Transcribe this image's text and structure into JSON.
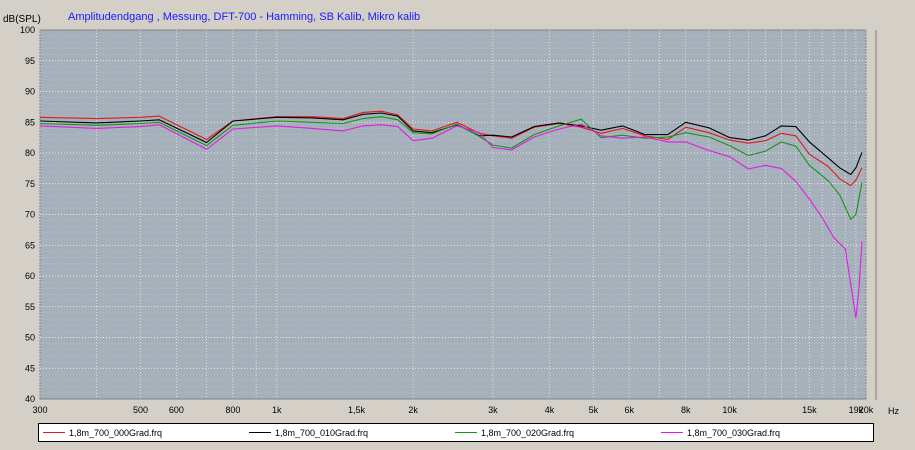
{
  "window_title": "Amplitudendgang , Messung, DFT-700 - Hamming, SB Kalib, Mikro kalib",
  "chart_data": {
    "type": "line",
    "title": "Amplitudendgang , Messung, DFT-700 - Hamming, SB Kalib, Mikro kalib",
    "ylabel": "dB(SPL)",
    "xlabel": "Hz",
    "xscale": "log",
    "xlim": [
      300,
      20000
    ],
    "ylim": [
      40,
      100
    ],
    "grid": true,
    "legend_placement": "bottom",
    "x_ticks": [
      {
        "v": 300,
        "label": "300"
      },
      {
        "v": 500,
        "label": "500"
      },
      {
        "v": 600,
        "label": "600"
      },
      {
        "v": 800,
        "label": "800"
      },
      {
        "v": 1000,
        "label": "1k"
      },
      {
        "v": 1500,
        "label": "1,5k"
      },
      {
        "v": 2000,
        "label": "2k"
      },
      {
        "v": 3000,
        "label": "3k"
      },
      {
        "v": 4000,
        "label": "4k"
      },
      {
        "v": 5000,
        "label": "5k"
      },
      {
        "v": 6000,
        "label": "6k"
      },
      {
        "v": 8000,
        "label": "8k"
      },
      {
        "v": 10000,
        "label": "10k"
      },
      {
        "v": 15000,
        "label": "15k"
      },
      {
        "v": 19000,
        "label": "19k"
      },
      {
        "v": 20000,
        "label": "20k"
      }
    ],
    "y_ticks": [
      100,
      95,
      90,
      85,
      80,
      75,
      70,
      65,
      60,
      55,
      50,
      45,
      40
    ],
    "colors": {
      "plot_bg": "#a5b0bb",
      "grid": "#ffffff",
      "title": "#1a1aff",
      "window_bg": "#d4d0c8"
    },
    "series": [
      {
        "name": "1,8m_700_000Grad.frq",
        "color": "#e01a1a",
        "points": [
          [
            300,
            85.8
          ],
          [
            400,
            85.6
          ],
          [
            500,
            85.8
          ],
          [
            550,
            86.0
          ],
          [
            700,
            82.2
          ],
          [
            800,
            85.2
          ],
          [
            1000,
            85.9
          ],
          [
            1200,
            85.9
          ],
          [
            1400,
            85.6
          ],
          [
            1550,
            86.6
          ],
          [
            1700,
            86.8
          ],
          [
            1850,
            86.2
          ],
          [
            2000,
            83.9
          ],
          [
            2200,
            83.6
          ],
          [
            2500,
            85.0
          ],
          [
            2800,
            83.2
          ],
          [
            3000,
            82.8
          ],
          [
            3300,
            82.4
          ],
          [
            3700,
            84.2
          ],
          [
            4200,
            84.8
          ],
          [
            4700,
            84.2
          ],
          [
            5200,
            83.2
          ],
          [
            5800,
            84.0
          ],
          [
            6500,
            82.8
          ],
          [
            7300,
            82.2
          ],
          [
            8000,
            84.2
          ],
          [
            9000,
            83.3
          ],
          [
            10000,
            82.1
          ],
          [
            11000,
            81.6
          ],
          [
            12000,
            82.0
          ],
          [
            13000,
            83.2
          ],
          [
            14000,
            82.8
          ],
          [
            15000,
            79.8
          ],
          [
            16500,
            77.8
          ],
          [
            17500,
            75.8
          ],
          [
            18500,
            74.7
          ],
          [
            19000,
            75.6
          ],
          [
            19600,
            77.6
          ]
        ]
      },
      {
        "name": "1,8m_700_010Grad.frq",
        "color": "#000000",
        "points": [
          [
            300,
            85.2
          ],
          [
            400,
            84.9
          ],
          [
            500,
            85.2
          ],
          [
            550,
            85.4
          ],
          [
            700,
            81.7
          ],
          [
            800,
            85.2
          ],
          [
            1000,
            85.8
          ],
          [
            1200,
            85.7
          ],
          [
            1400,
            85.4
          ],
          [
            1550,
            86.3
          ],
          [
            1700,
            86.5
          ],
          [
            1850,
            86.0
          ],
          [
            2000,
            83.6
          ],
          [
            2200,
            83.3
          ],
          [
            2500,
            84.6
          ],
          [
            2800,
            82.8
          ],
          [
            3000,
            82.9
          ],
          [
            3300,
            82.6
          ],
          [
            3700,
            84.3
          ],
          [
            4200,
            84.9
          ],
          [
            4700,
            84.4
          ],
          [
            5200,
            83.7
          ],
          [
            5800,
            84.4
          ],
          [
            6500,
            83.0
          ],
          [
            7300,
            83.0
          ],
          [
            8000,
            85.0
          ],
          [
            9000,
            84.1
          ],
          [
            10000,
            82.5
          ],
          [
            11000,
            82.1
          ],
          [
            12000,
            82.8
          ],
          [
            13000,
            84.4
          ],
          [
            14000,
            84.3
          ],
          [
            15000,
            81.8
          ],
          [
            16500,
            79.2
          ],
          [
            17500,
            77.6
          ],
          [
            18500,
            76.5
          ],
          [
            19000,
            77.6
          ],
          [
            19600,
            80.1
          ]
        ]
      },
      {
        "name": "1,8m_700_020Grad.frq",
        "color": "#149614",
        "points": [
          [
            300,
            84.8
          ],
          [
            400,
            84.5
          ],
          [
            500,
            84.8
          ],
          [
            550,
            85.0
          ],
          [
            700,
            81.2
          ],
          [
            800,
            84.5
          ],
          [
            1000,
            85.2
          ],
          [
            1200,
            85.0
          ],
          [
            1400,
            84.8
          ],
          [
            1550,
            85.6
          ],
          [
            1700,
            85.9
          ],
          [
            1850,
            85.4
          ],
          [
            2000,
            83.3
          ],
          [
            2200,
            83.1
          ],
          [
            2500,
            84.7
          ],
          [
            2800,
            82.7
          ],
          [
            3000,
            81.3
          ],
          [
            3300,
            80.8
          ],
          [
            3700,
            83.0
          ],
          [
            4200,
            84.4
          ],
          [
            4700,
            85.5
          ],
          [
            5200,
            82.5
          ],
          [
            5800,
            82.9
          ],
          [
            6500,
            82.4
          ],
          [
            7300,
            82.6
          ],
          [
            8000,
            83.3
          ],
          [
            9000,
            82.6
          ],
          [
            10000,
            81.2
          ],
          [
            11000,
            79.6
          ],
          [
            12000,
            80.3
          ],
          [
            13000,
            81.8
          ],
          [
            14000,
            81.1
          ],
          [
            15000,
            78.0
          ],
          [
            16500,
            75.5
          ],
          [
            17500,
            73.2
          ],
          [
            18500,
            69.2
          ],
          [
            19000,
            70.0
          ],
          [
            19600,
            75.2
          ]
        ]
      },
      {
        "name": "1,8m_700_030Grad.frq",
        "color": "#e41ae4",
        "points": [
          [
            300,
            84.4
          ],
          [
            400,
            84.0
          ],
          [
            500,
            84.3
          ],
          [
            550,
            84.6
          ],
          [
            700,
            80.6
          ],
          [
            800,
            83.9
          ],
          [
            1000,
            84.4
          ],
          [
            1200,
            84.0
          ],
          [
            1400,
            83.6
          ],
          [
            1550,
            84.4
          ],
          [
            1700,
            84.6
          ],
          [
            1850,
            84.3
          ],
          [
            2000,
            82.0
          ],
          [
            2200,
            82.4
          ],
          [
            2500,
            84.4
          ],
          [
            2800,
            83.3
          ],
          [
            3000,
            80.9
          ],
          [
            3300,
            80.5
          ],
          [
            3700,
            82.6
          ],
          [
            4200,
            83.9
          ],
          [
            4700,
            84.7
          ],
          [
            5200,
            82.8
          ],
          [
            5800,
            82.4
          ],
          [
            6500,
            82.6
          ],
          [
            7300,
            81.8
          ],
          [
            8000,
            81.8
          ],
          [
            9000,
            80.4
          ],
          [
            10000,
            79.4
          ],
          [
            11000,
            77.4
          ],
          [
            12000,
            78.0
          ],
          [
            13000,
            77.5
          ],
          [
            14000,
            75.4
          ],
          [
            15000,
            72.5
          ],
          [
            16000,
            69.5
          ],
          [
            17000,
            66.2
          ],
          [
            18000,
            64.4
          ],
          [
            18700,
            56.5
          ],
          [
            19000,
            53.2
          ],
          [
            19300,
            58.0
          ],
          [
            19600,
            65.6
          ]
        ]
      }
    ]
  }
}
